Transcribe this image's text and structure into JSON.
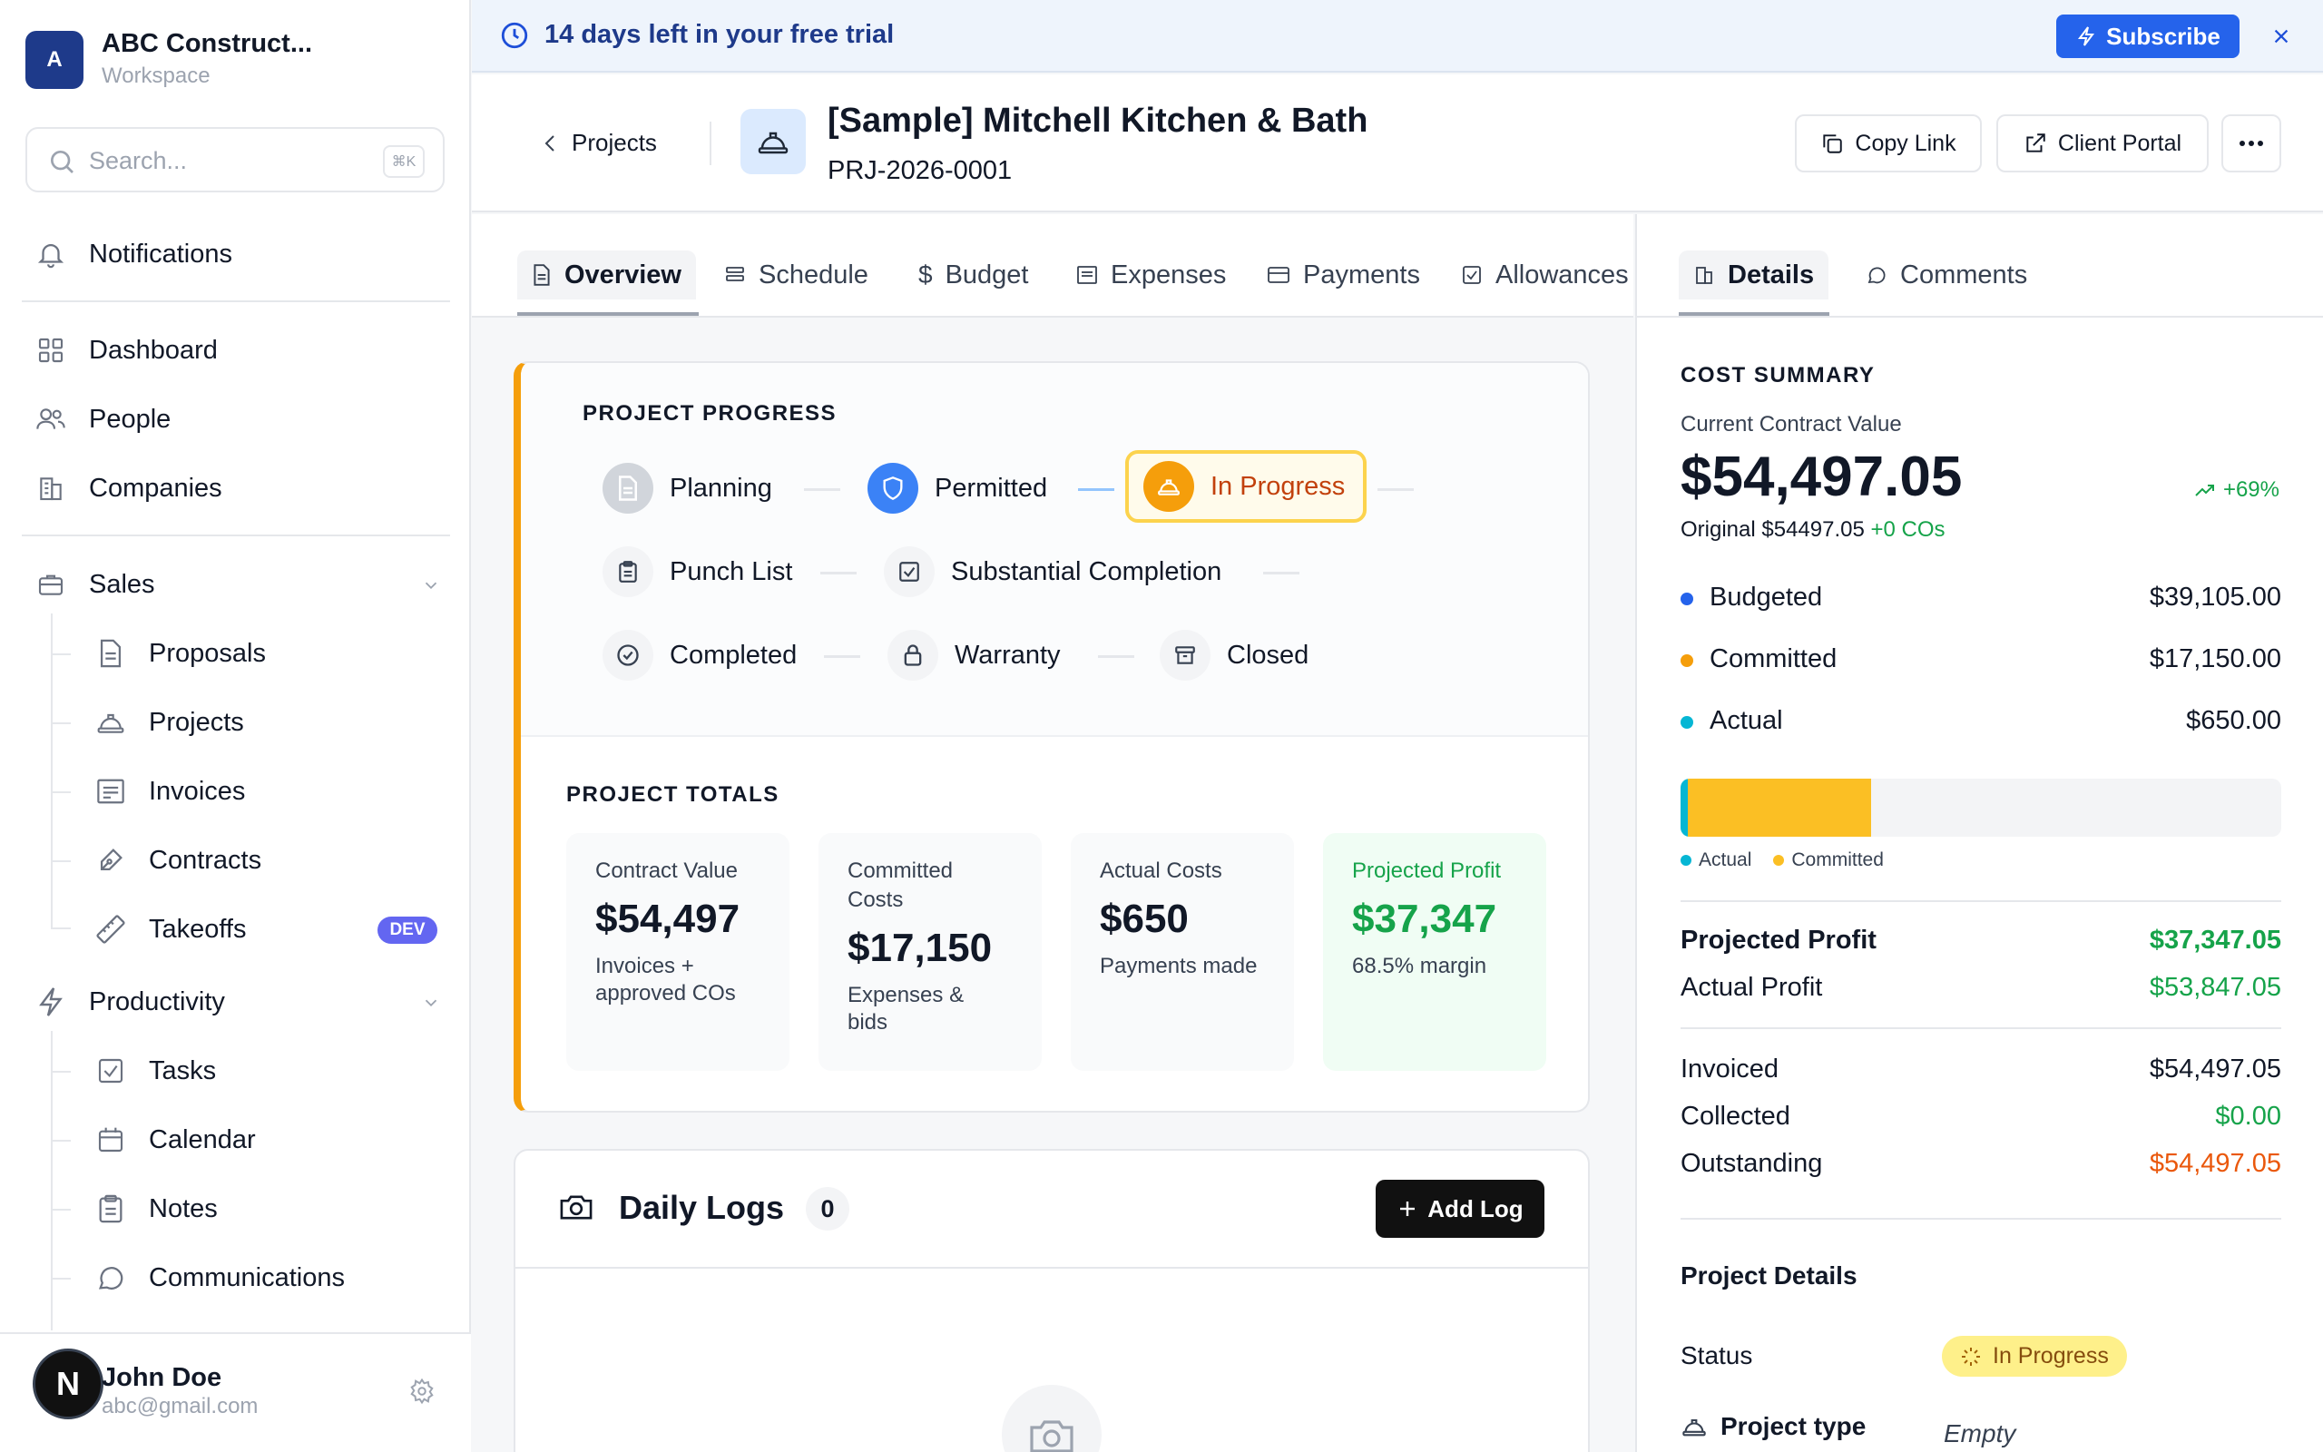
{
  "workspace": {
    "initial": "A",
    "name": "ABC Construct...",
    "subtitle": "Workspace"
  },
  "search": {
    "placeholder": "Search...",
    "shortcut": "⌘K"
  },
  "sidebar": {
    "notifications": "Notifications",
    "main": [
      {
        "label": "Dashboard",
        "icon": "grid-icon"
      },
      {
        "label": "People",
        "icon": "users-icon"
      },
      {
        "label": "Companies",
        "icon": "building-icon"
      }
    ],
    "sales": {
      "label": "Sales",
      "items": [
        {
          "label": "Proposals",
          "icon": "document-icon"
        },
        {
          "label": "Projects",
          "icon": "hardhat-icon"
        },
        {
          "label": "Invoices",
          "icon": "invoice-icon"
        },
        {
          "label": "Contracts",
          "icon": "pen-icon"
        },
        {
          "label": "Takeoffs",
          "icon": "ruler-icon",
          "badge": "DEV"
        }
      ]
    },
    "productivity": {
      "label": "Productivity",
      "items": [
        {
          "label": "Tasks",
          "icon": "checkbox-icon"
        },
        {
          "label": "Calendar",
          "icon": "calendar-icon"
        },
        {
          "label": "Notes",
          "icon": "clipboard-icon"
        },
        {
          "label": "Communications",
          "icon": "chat-icon"
        }
      ]
    }
  },
  "user": {
    "initial": "N",
    "name": "John Doe",
    "email": "abc@gmail.com"
  },
  "trial": {
    "text": "14 days left in your free trial",
    "subscribe": "Subscribe"
  },
  "header": {
    "back": "Projects",
    "title": "[Sample] Mitchell Kitchen & Bath",
    "code": "PRJ-2026-0001",
    "copy_link": "Copy Link",
    "client_portal": "Client Portal"
  },
  "tabs": [
    "Overview",
    "Schedule",
    "Budget",
    "Expenses",
    "Payments",
    "Allowances"
  ],
  "right_tabs": [
    "Details",
    "Comments"
  ],
  "progress": {
    "label": "PROJECT PROGRESS",
    "steps": [
      "Planning",
      "Permitted",
      "In Progress",
      "Punch List",
      "Substantial Completion",
      "Completed",
      "Warranty",
      "Closed"
    ],
    "current": "In Progress"
  },
  "totals": {
    "label": "PROJECT TOTALS",
    "cards": [
      {
        "label": "Contract Value",
        "value": "$54,497",
        "sub": "Invoices + approved COs"
      },
      {
        "label": "Committed Costs",
        "value": "$17,150",
        "sub": "Expenses & bids"
      },
      {
        "label": "Actual Costs",
        "value": "$650",
        "sub": "Payments made"
      },
      {
        "label": "Projected Profit",
        "value": "$37,347",
        "sub": "68.5% margin"
      }
    ]
  },
  "logs": {
    "title": "Daily Logs",
    "count": "0",
    "add": "Add Log"
  },
  "cost_summary": {
    "label": "COST SUMMARY",
    "current_label": "Current Contract Value",
    "current_value": "$54,497.05",
    "trend": "+69%",
    "original_prefix": "Original $54497.05",
    "original_cos": "+0 COs",
    "lines": [
      {
        "label": "Budgeted",
        "value": "$39,105.00",
        "color": "#2563eb"
      },
      {
        "label": "Committed",
        "value": "$17,150.00",
        "color": "#f59e0b"
      },
      {
        "label": "Actual",
        "value": "$650.00",
        "color": "#06b6d4"
      }
    ],
    "bar": {
      "actual_fraction": 0.012,
      "committed_fraction": 0.305
    },
    "legend": [
      "Actual",
      "Committed"
    ],
    "projected_profit_label": "Projected Profit",
    "projected_profit": "$37,347.05",
    "actual_profit_label": "Actual Profit",
    "actual_profit": "$53,847.05",
    "invoiced_label": "Invoiced",
    "invoiced": "$54,497.05",
    "collected_label": "Collected",
    "collected": "$0.00",
    "outstanding_label": "Outstanding",
    "outstanding": "$54,497.05"
  },
  "project_details": {
    "label": "Project Details",
    "status_label": "Status",
    "status": "In Progress",
    "type_label": "Project type",
    "type": "Empty"
  }
}
